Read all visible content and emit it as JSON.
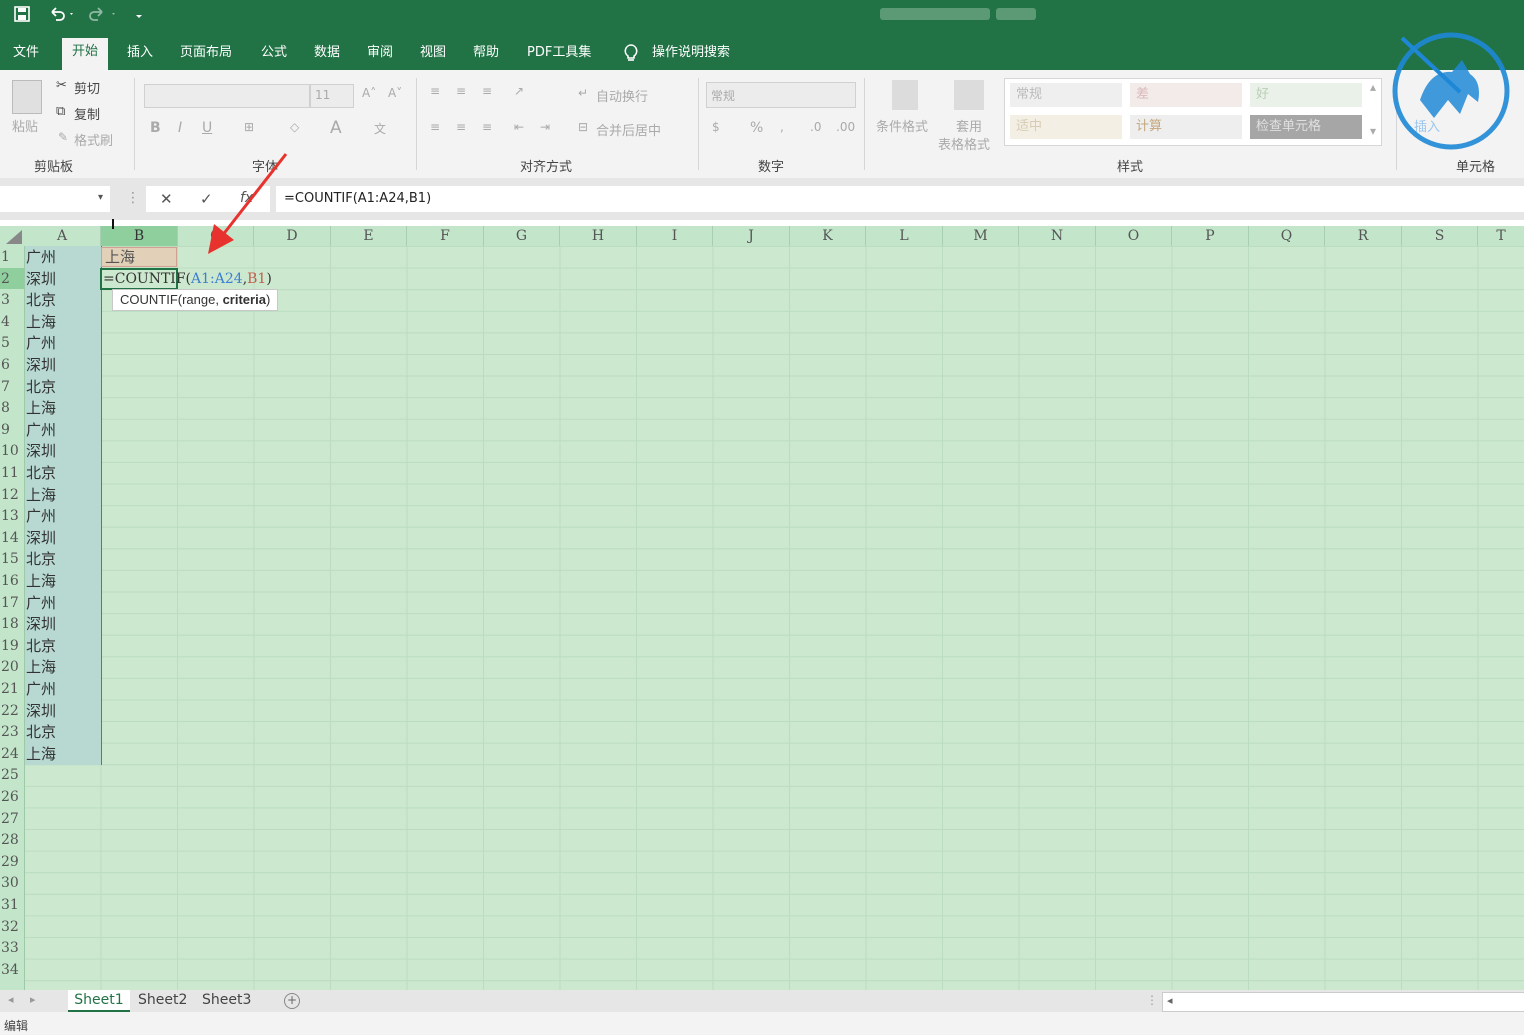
{
  "qat": {
    "save_icon": "save-icon",
    "undo_icon": "undo-icon",
    "redo_icon": "redo-icon"
  },
  "tabs": [
    "文件",
    "开始",
    "插入",
    "页面布局",
    "公式",
    "数据",
    "审阅",
    "视图",
    "帮助",
    "PDF工具集",
    "操作说明搜索"
  ],
  "ribbon": {
    "clipboard": {
      "paste": "粘贴",
      "cut": "剪切",
      "copy": "复制",
      "format_painter": "格式刷",
      "label": "剪贴板"
    },
    "font": {
      "size": "11",
      "bold": "B",
      "italic": "I",
      "underline": "U",
      "label": "字体"
    },
    "alignment": {
      "wrap": "自动换行",
      "merge": "合并后居中",
      "label": "对齐方式"
    },
    "number": {
      "format": "常规",
      "percent": "%",
      "label": "数字"
    },
    "styles": {
      "conditional": "条件格式",
      "table_format_1": "套用",
      "table_format_2": "表格格式",
      "normal": "常规",
      "bad": "差",
      "good": "好",
      "neutral": "适中",
      "calc": "计算",
      "check": "检查单元格",
      "label": "样式"
    },
    "cells": {
      "insert": "插入",
      "label": "单元格"
    }
  },
  "formula_bar": {
    "cancel": "✕",
    "enter": "✓",
    "fx": "fx",
    "formula": "=COUNTIF(A1:A24,B1)"
  },
  "columns": [
    "A",
    "B",
    "C",
    "D",
    "E",
    "F",
    "G",
    "H",
    "I",
    "J",
    "K",
    "L",
    "M",
    "N",
    "O",
    "P",
    "Q",
    "R",
    "S",
    "T"
  ],
  "rows": [
    "1",
    "2",
    "3",
    "4",
    "5",
    "6",
    "7",
    "8",
    "9",
    "10",
    "11",
    "12",
    "13",
    "14",
    "15",
    "16",
    "17",
    "18",
    "19",
    "20",
    "21",
    "22",
    "23",
    "24",
    "25",
    "26",
    "27",
    "28",
    "29",
    "30",
    "31",
    "32",
    "33",
    "34"
  ],
  "col_a": [
    "广州",
    "深圳",
    "北京",
    "上海",
    "广州",
    "深圳",
    "北京",
    "上海",
    "广州",
    "深圳",
    "北京",
    "上海",
    "广州",
    "深圳",
    "北京",
    "上海",
    "广州",
    "深圳",
    "北京",
    "上海",
    "广州",
    "深圳",
    "北京",
    "上海"
  ],
  "b1": "上海",
  "b2_formula": {
    "prefix": "=COUNTIF(",
    "range": "A1:A24",
    "sep": ",",
    "ref": "B1",
    "suffix": ")"
  },
  "tooltip": {
    "fn": "COUNTIF(range, ",
    "arg": "criteria",
    "end": ")"
  },
  "sheets": [
    "Sheet1",
    "Sheet2",
    "Sheet3"
  ],
  "status": "编辑",
  "colors": {
    "excel_green": "#217346",
    "grid_bg": "#cce8cf",
    "arrow_red": "#e8322d",
    "logo_blue": "#1e88d6"
  }
}
